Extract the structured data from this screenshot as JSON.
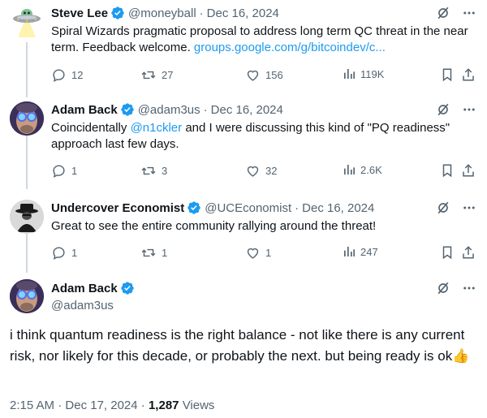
{
  "tweets": [
    {
      "name": "Steve Lee",
      "handle": "@moneyball",
      "date": "Dec 16, 2024",
      "text": "Spiral Wizards pragmatic proposal to address long term QC threat in the near term. Feedback welcome. ",
      "link": "groups.google.com/g/bitcoindev/c...",
      "replies": "12",
      "reposts": "27",
      "likes": "156",
      "views": "119K"
    },
    {
      "name": "Adam Back",
      "handle": "@adam3us",
      "date": "Dec 16, 2024",
      "text_before": "Coincidentally ",
      "mention": "@n1ckler",
      "text_after": " and I were discussing this kind of \"PQ readiness\" approach last few days.",
      "replies": "1",
      "reposts": "3",
      "likes": "32",
      "views": "2.6K"
    },
    {
      "name": "Undercover Economist",
      "handle": "@UCEconomist",
      "date": "Dec 16, 2024",
      "text": "Great to see the entire community rallying around the threat!",
      "replies": "1",
      "reposts": "1",
      "likes": "1",
      "views": "247"
    }
  ],
  "main_tweet": {
    "name": "Adam Back",
    "handle": "@adam3us",
    "text": "i think quantum readiness is the right balance - not like there is any current risk, nor likely for this decade, or probably the next. but being ready is ok",
    "emoji": "👍",
    "time": "2:15 AM",
    "date": "Dec 17, 2024",
    "views_count": "1,287",
    "views_label": "Views"
  },
  "separator": "·",
  "colors": {
    "link": "#1d9bf0",
    "verified": "#1d9bf0",
    "muted": "#536471",
    "text": "#0f1419"
  },
  "icons": [
    "ufo-avatar",
    "verified-badge-icon",
    "grok-icon",
    "more-icon",
    "reply-icon",
    "repost-icon",
    "like-icon",
    "views-icon",
    "bookmark-icon",
    "share-icon"
  ]
}
